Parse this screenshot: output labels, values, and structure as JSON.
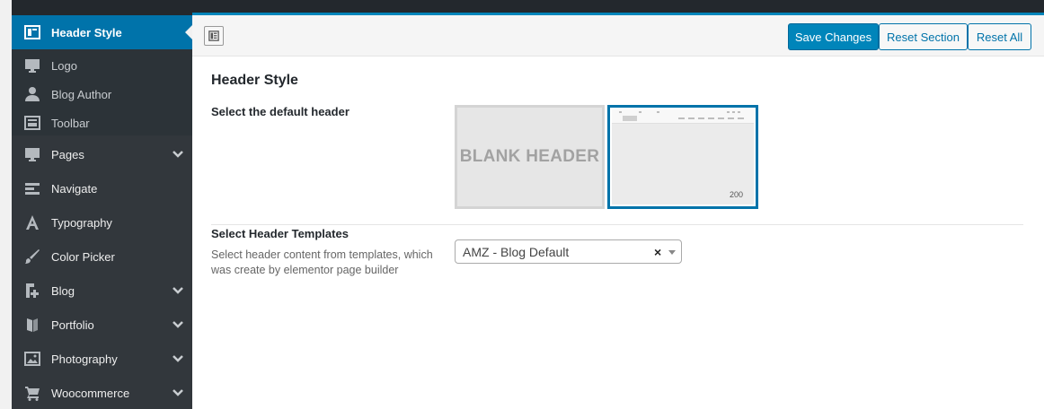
{
  "sidebar": {
    "active_item": {
      "label": "Header Style",
      "icon": "layout-icon"
    },
    "subitems": [
      {
        "label": "Logo",
        "icon": "monitor-icon"
      },
      {
        "label": "Blog Author",
        "icon": "user-icon"
      },
      {
        "label": "Toolbar",
        "icon": "layout-icon"
      }
    ],
    "items": [
      {
        "label": "Pages",
        "icon": "monitor-icon",
        "expandable": true
      },
      {
        "label": "Navigate",
        "icon": "menu-bars-icon",
        "expandable": false
      },
      {
        "label": "Typography",
        "icon": "typography-icon",
        "expandable": false
      },
      {
        "label": "Color Picker",
        "icon": "brush-icon",
        "expandable": false
      },
      {
        "label": "Blog",
        "icon": "post-add-icon",
        "expandable": true
      },
      {
        "label": "Portfolio",
        "icon": "portfolio-icon",
        "expandable": true
      },
      {
        "label": "Photography",
        "icon": "image-icon",
        "expandable": true
      },
      {
        "label": "Woocommerce",
        "icon": "cart-icon",
        "expandable": true
      }
    ]
  },
  "toolbar": {
    "save_label": "Save Changes",
    "reset_section_label": "Reset Section",
    "reset_all_label": "Reset All"
  },
  "section": {
    "title": "Header Style",
    "default_header": {
      "label": "Select the default header",
      "options": [
        {
          "label": "BLANK HEADER",
          "selected": false
        },
        {
          "label": "200",
          "selected": true
        }
      ]
    },
    "templates": {
      "label": "Select Header Templates",
      "description": "Select header content from templates, which was create by elementor page builder",
      "selected_value": "AMZ - Blog Default",
      "clear_glyph": "×"
    }
  },
  "colors": {
    "accent": "#0073aa",
    "sidebar_bg": "#32373c",
    "topbar_bg": "#23282d"
  }
}
